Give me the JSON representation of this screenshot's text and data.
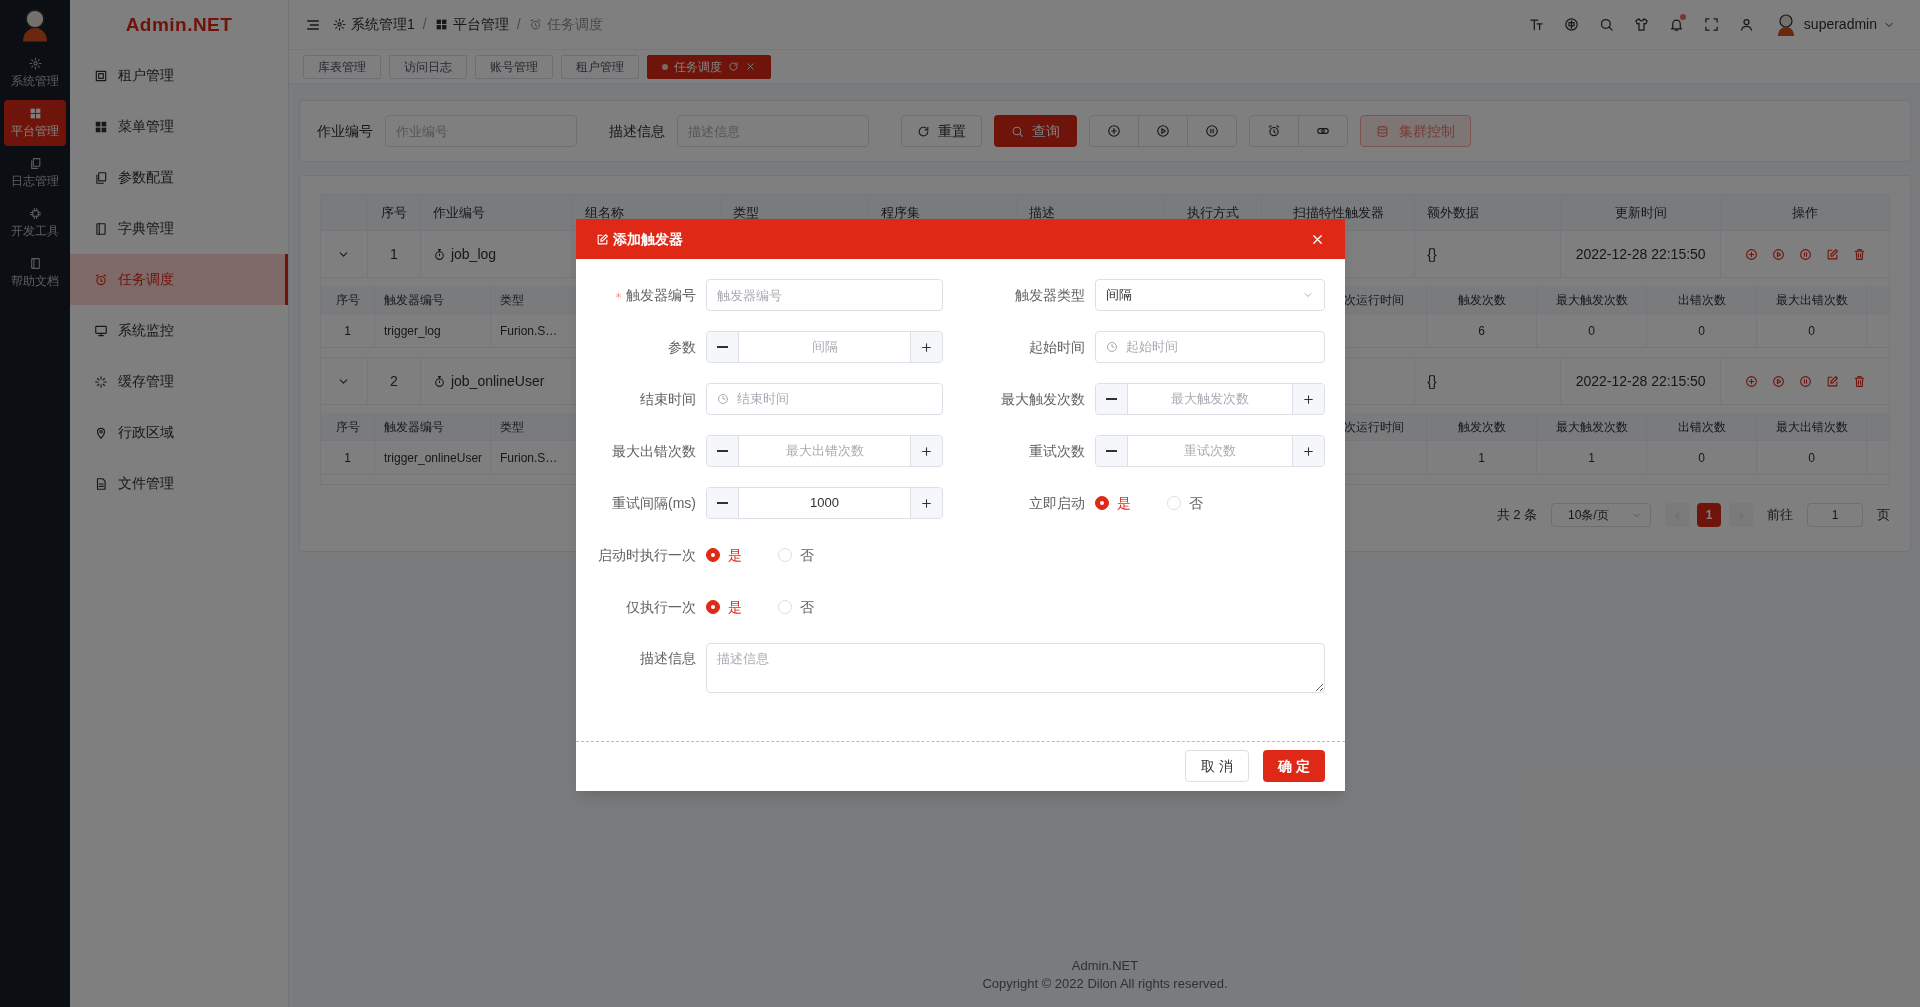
{
  "rail": {
    "items": [
      {
        "label": "系统管理",
        "selected": false
      },
      {
        "label": "平台管理",
        "selected": true
      },
      {
        "label": "日志管理",
        "selected": false
      },
      {
        "label": "开发工具",
        "selected": false
      },
      {
        "label": "帮助文档",
        "selected": false
      }
    ]
  },
  "sidebar": {
    "title": "Admin.NET",
    "items": [
      {
        "label": "租户管理",
        "selected": false
      },
      {
        "label": "菜单管理",
        "selected": false
      },
      {
        "label": "参数配置",
        "selected": false
      },
      {
        "label": "字典管理",
        "selected": false
      },
      {
        "label": "任务调度",
        "selected": true
      },
      {
        "label": "系统监控",
        "selected": false
      },
      {
        "label": "缓存管理",
        "selected": false
      },
      {
        "label": "行政区域",
        "selected": false
      },
      {
        "label": "文件管理",
        "selected": false
      }
    ]
  },
  "header": {
    "breadcrumb": [
      "系统管理1",
      "平台管理",
      "任务调度"
    ],
    "breadcrumb_separators": [
      "/",
      "/"
    ],
    "has_notifications": true,
    "user": "superadmin"
  },
  "tabs": [
    {
      "label": "库表管理",
      "selected": false
    },
    {
      "label": "访问日志",
      "selected": false
    },
    {
      "label": "账号管理",
      "selected": false
    },
    {
      "label": "租户管理",
      "selected": false
    },
    {
      "label": "任务调度",
      "selected": true
    }
  ],
  "search": {
    "fields": [
      {
        "label": "作业编号",
        "placeholder": "作业编号"
      },
      {
        "label": "描述信息",
        "placeholder": "描述信息"
      }
    ],
    "reset": "重置",
    "query": "查询",
    "cluster": "集群控制"
  },
  "table": {
    "columns": [
      "序号",
      "作业编号",
      "组名称",
      "类型",
      "程序集",
      "描述",
      "执行方式",
      "扫描特性触发器",
      "额外数据",
      "更新时间",
      "操作"
    ],
    "rows": [
      {
        "index": "1",
        "job_id": "job_log",
        "extra_data": "{}",
        "updated": "2022-12-28 22:15:50",
        "expanded": true,
        "triggers": {
          "columns": [
            "序号",
            "触发器编号",
            "类型",
            "次运行时间",
            "触发次数",
            "最大触发次数",
            "出错次数",
            "最大出错次数"
          ],
          "rows": [
            {
              "index": "1",
              "trigger_id": "trigger_log",
              "type": "Furion.S…",
              "fire_count": "6",
              "max_fire_count": "0",
              "error_count": "0",
              "max_error_count": "0"
            }
          ]
        }
      },
      {
        "index": "2",
        "job_id": "job_onlineUser",
        "extra_data": "{}",
        "updated": "2022-12-28 22:15:50",
        "expanded": true,
        "triggers": {
          "columns": [
            "序号",
            "触发器编号",
            "类型",
            "次运行时间",
            "触发次数",
            "最大触发次数",
            "出错次数",
            "最大出错次数"
          ],
          "rows": [
            {
              "index": "1",
              "trigger_id": "trigger_onlineUser",
              "type": "Furion.S…",
              "fire_count": "1",
              "max_fire_count": "1",
              "error_count": "0",
              "max_error_count": "0"
            }
          ]
        }
      }
    ]
  },
  "pagination": {
    "total": "共 2 条",
    "page_size": "10条/页",
    "pages": [
      {
        "label": "1",
        "selected": true
      }
    ],
    "goto_label": "前往",
    "goto_value": "1",
    "page_unit": "页"
  },
  "dialog": {
    "title": "添加触发器",
    "grid_fields": [
      {
        "kind": "text",
        "label": "触发器编号",
        "required": true,
        "placeholder": "触发器编号"
      },
      {
        "kind": "select",
        "label": "触发器类型",
        "value": "间隔"
      },
      {
        "kind": "stepper",
        "label": "参数",
        "placeholder": "间隔"
      },
      {
        "kind": "date",
        "label": "起始时间",
        "placeholder": "起始时间"
      },
      {
        "kind": "date",
        "label": "结束时间",
        "placeholder": "结束时间"
      },
      {
        "kind": "stepper",
        "label": "最大触发次数",
        "placeholder": "最大触发次数"
      },
      {
        "kind": "stepper",
        "label": "最大出错次数",
        "placeholder": "最大出错次数"
      },
      {
        "kind": "stepper",
        "label": "重试次数",
        "placeholder": "重试次数"
      },
      {
        "kind": "stepper",
        "label": "重试间隔(ms)",
        "value": "1000"
      },
      {
        "kind": "radio",
        "label": "立即启动",
        "options": [
          {
            "label": "是",
            "selected": true
          },
          {
            "label": "否",
            "selected": false
          }
        ]
      }
    ],
    "row_fields": [
      {
        "kind": "radio",
        "label": "启动时执行一次",
        "options": [
          {
            "label": "是",
            "selected": true
          },
          {
            "label": "否",
            "selected": false
          }
        ]
      },
      {
        "kind": "radio",
        "label": "仅执行一次",
        "options": [
          {
            "label": "是",
            "selected": true
          },
          {
            "label": "否",
            "selected": false
          }
        ]
      }
    ],
    "description": {
      "label": "描述信息",
      "placeholder": "描述信息"
    },
    "cancel": "取 消",
    "confirm": "确 定"
  },
  "footer": [
    "Admin.NET",
    "Copyright © 2022 Dilon All rights reserved."
  ]
}
